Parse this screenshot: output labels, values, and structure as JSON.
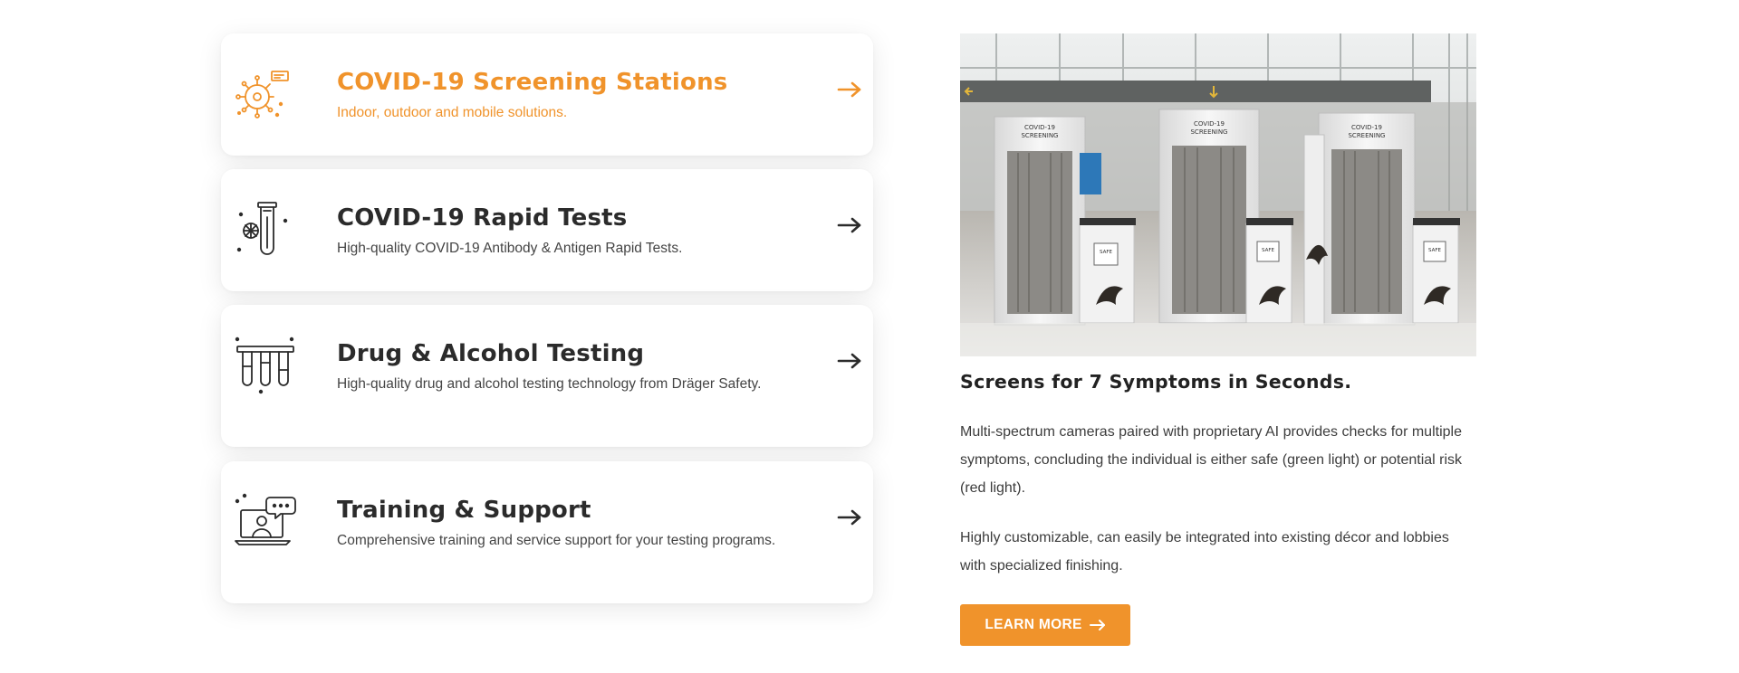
{
  "services": [
    {
      "title": "COVID-19 Screening Stations",
      "description": "Indoor, outdoor and mobile solutions.",
      "icon": "virus-screening-icon",
      "active": true
    },
    {
      "title": "COVID-19 Rapid Tests",
      "description": "High-quality COVID-19 Antibody & Antigen Rapid Tests.",
      "icon": "test-tube-icon",
      "active": false
    },
    {
      "title": "Drug & Alcohol Testing",
      "description": "High-quality drug and alcohol testing technology from  Dräger Safety.",
      "icon": "test-tubes-rack-icon",
      "active": false
    },
    {
      "title": "Training & Support",
      "description": "Comprehensive training and service support for your testing programs.",
      "icon": "laptop-chat-icon",
      "active": false
    }
  ],
  "detail": {
    "image": {
      "station_label": "COVID-19 SCREENING",
      "kiosk_label": "SAFE"
    },
    "headline": "Screens for 7 Symptoms in Seconds.",
    "paragraph_1": "Multi-spectrum cameras paired with proprietary AI provides checks for multiple symptoms, concluding the individual is either safe (green light) or potential risk (red light).",
    "paragraph_2": "Highly customizable, can easily be integrated into existing décor and lobbies with specialized finishing.",
    "button_label": "LEARN MORE"
  },
  "colors": {
    "accent": "#f0932b",
    "text_dark": "#2b2b2b",
    "card_bg": "#ffffff"
  }
}
